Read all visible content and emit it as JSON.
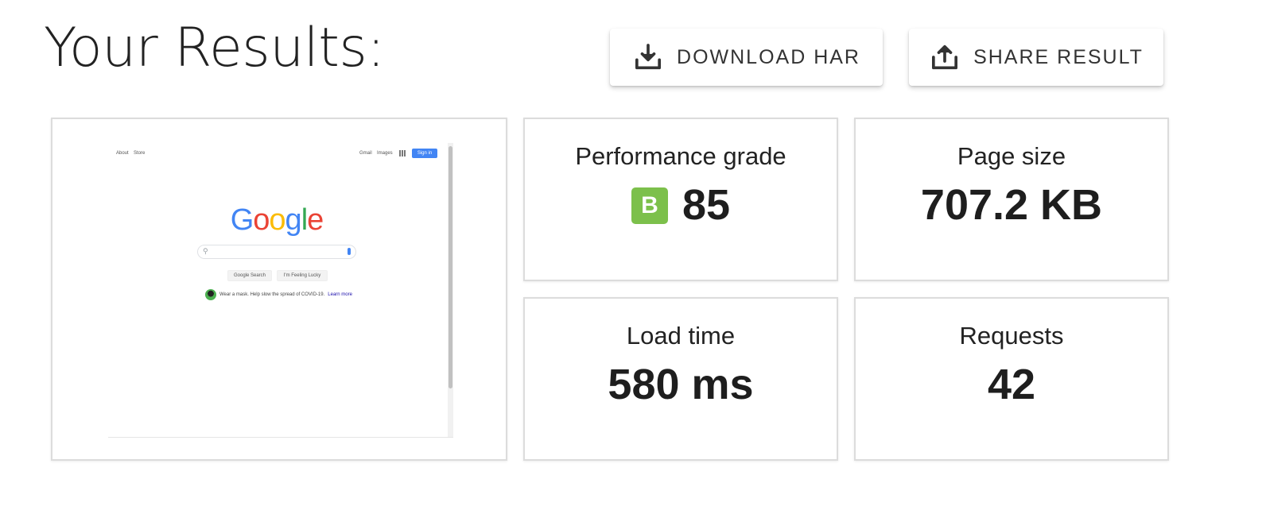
{
  "header": {
    "title": "Your Results:"
  },
  "actions": {
    "download": {
      "label": "DOWNLOAD HAR",
      "icon": "download-icon"
    },
    "share": {
      "label": "SHARE RESULT",
      "icon": "share-icon"
    }
  },
  "screenshot": {
    "nav_left": [
      "About",
      "Store"
    ],
    "nav_right": [
      "Gmail",
      "Images"
    ],
    "sign_in": "Sign in",
    "logo": "Google",
    "buttons": [
      "Google Search",
      "I'm Feeling Lucky"
    ],
    "notice": "Wear a mask. Help slow the spread of COVID-19.",
    "notice_link": "Learn more"
  },
  "metrics": {
    "performance": {
      "label": "Performance grade",
      "grade": "B",
      "value": "85",
      "grade_color": "#7cc04b"
    },
    "page_size": {
      "label": "Page size",
      "value": "707.2 KB"
    },
    "load_time": {
      "label": "Load time",
      "value": "580 ms"
    },
    "requests": {
      "label": "Requests",
      "value": "42"
    }
  },
  "colors": {
    "google_blue": "#4285f4",
    "google_red": "#ea4335",
    "google_yellow": "#fbbc05",
    "google_green": "#34a853"
  }
}
